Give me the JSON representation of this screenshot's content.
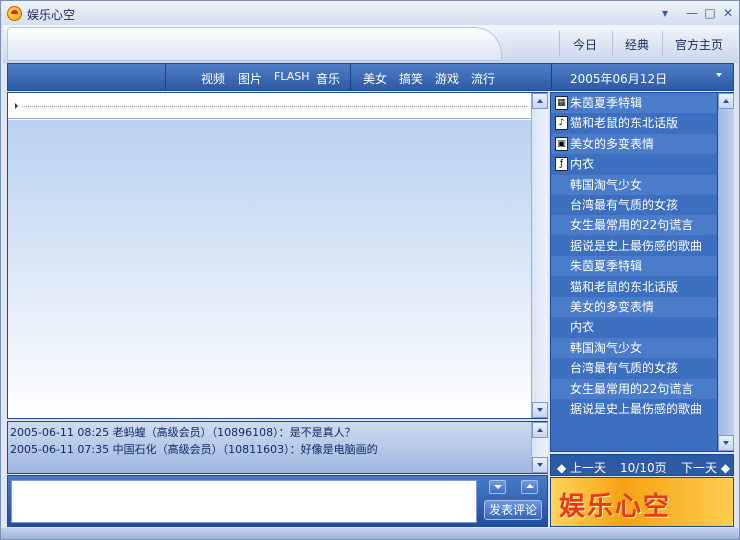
{
  "window": {
    "title": "娱乐心空"
  },
  "top_nav": {
    "today": "今日",
    "classic": "经典",
    "homepage": "官方主页"
  },
  "categories": [
    "视频",
    "图片",
    "FLASH",
    "音乐",
    "美女",
    "搞笑",
    "游戏",
    "流行"
  ],
  "date": {
    "selected": "2005年06月12日"
  },
  "comments": [
    "2005-06-11 08:25 老蚂蝗（高级会员）（10896108）：是不是真人？",
    "2005-06-11 07:35 中国石化（高级会员）（10811603）：好像是电脑画的"
  ],
  "input": {
    "value": "",
    "post_label": "发表评论"
  },
  "list": [
    {
      "label": "朱茵夏季特辑",
      "icon": "film-icon"
    },
    {
      "label": "猫和老鼠的东北话版",
      "icon": "music-icon"
    },
    {
      "label": "美女的多变表情",
      "icon": "image-icon"
    },
    {
      "label": "内衣",
      "icon": "flash-icon"
    },
    {
      "label": "韩国淘气少女",
      "icon": ""
    },
    {
      "label": "台湾最有气质的女孩",
      "icon": ""
    },
    {
      "label": "女生最常用的22句谎言",
      "icon": ""
    },
    {
      "label": "据说是史上最伤感的歌曲",
      "icon": ""
    },
    {
      "label": "朱茵夏季特辑",
      "icon": ""
    },
    {
      "label": "猫和老鼠的东北话版",
      "icon": ""
    },
    {
      "label": "美女的多变表情",
      "icon": ""
    },
    {
      "label": "内衣",
      "icon": ""
    },
    {
      "label": "韩国淘气少女",
      "icon": ""
    },
    {
      "label": "台湾最有气质的女孩",
      "icon": ""
    },
    {
      "label": "女生最常用的22句谎言",
      "icon": ""
    },
    {
      "label": "据说是史上最伤感的歌曲",
      "icon": ""
    }
  ],
  "pager": {
    "prev": "上一天",
    "page": "10/10页",
    "next": "下一天"
  },
  "logo": {
    "text": "娱乐心空"
  }
}
